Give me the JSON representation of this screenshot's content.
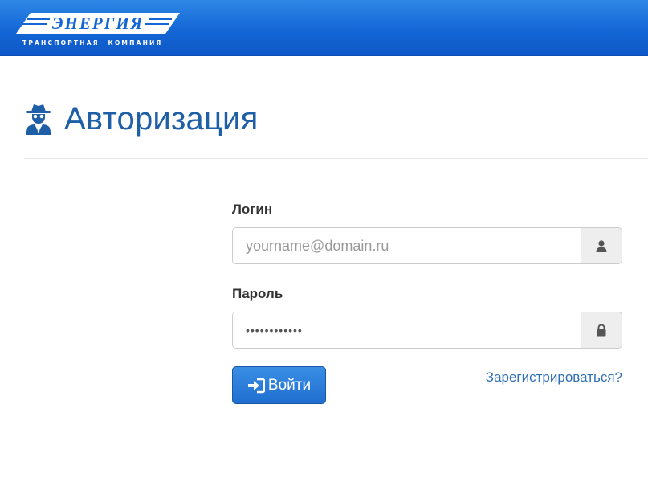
{
  "header": {
    "logo_text": "ЭНЕРГИЯ",
    "logo_subtitle": "ТРАНСПОРТНАЯ КОМПАНИЯ",
    "logo_icon": "energiya-logo",
    "bar_color": "#1466d6"
  },
  "page": {
    "title": "Авторизация",
    "title_icon": "user-secret-icon",
    "title_color": "#1f5fa8"
  },
  "form": {
    "login_label": "Логин",
    "login_placeholder": "yourname@domain.ru",
    "login_value": "",
    "login_addon_icon": "user-icon",
    "password_label": "Пароль",
    "password_value": "••••••••••••",
    "password_addon_icon": "lock-icon",
    "submit_label": "Войти",
    "submit_icon": "sign-in-icon",
    "register_link": "Зарегистрироваться?"
  },
  "colors": {
    "accent": "#1f6fd0",
    "link": "#2f6fb8",
    "label": "#333333"
  }
}
